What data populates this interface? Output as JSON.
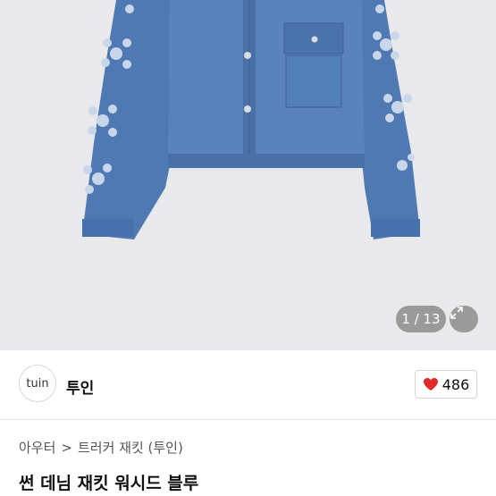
{
  "gallery": {
    "counter_text": "1 / 13",
    "expand_icon": "expand-icon"
  },
  "shop": {
    "logo_text": "tuin",
    "name": "투인",
    "like_count": "486",
    "like_color": "#e02b2b"
  },
  "breadcrumb": {
    "root": "아우터",
    "separator": ">",
    "category": "트러커 재킷 (투인)"
  },
  "product": {
    "title": "썬 데님 재킷 워시드 블루"
  }
}
